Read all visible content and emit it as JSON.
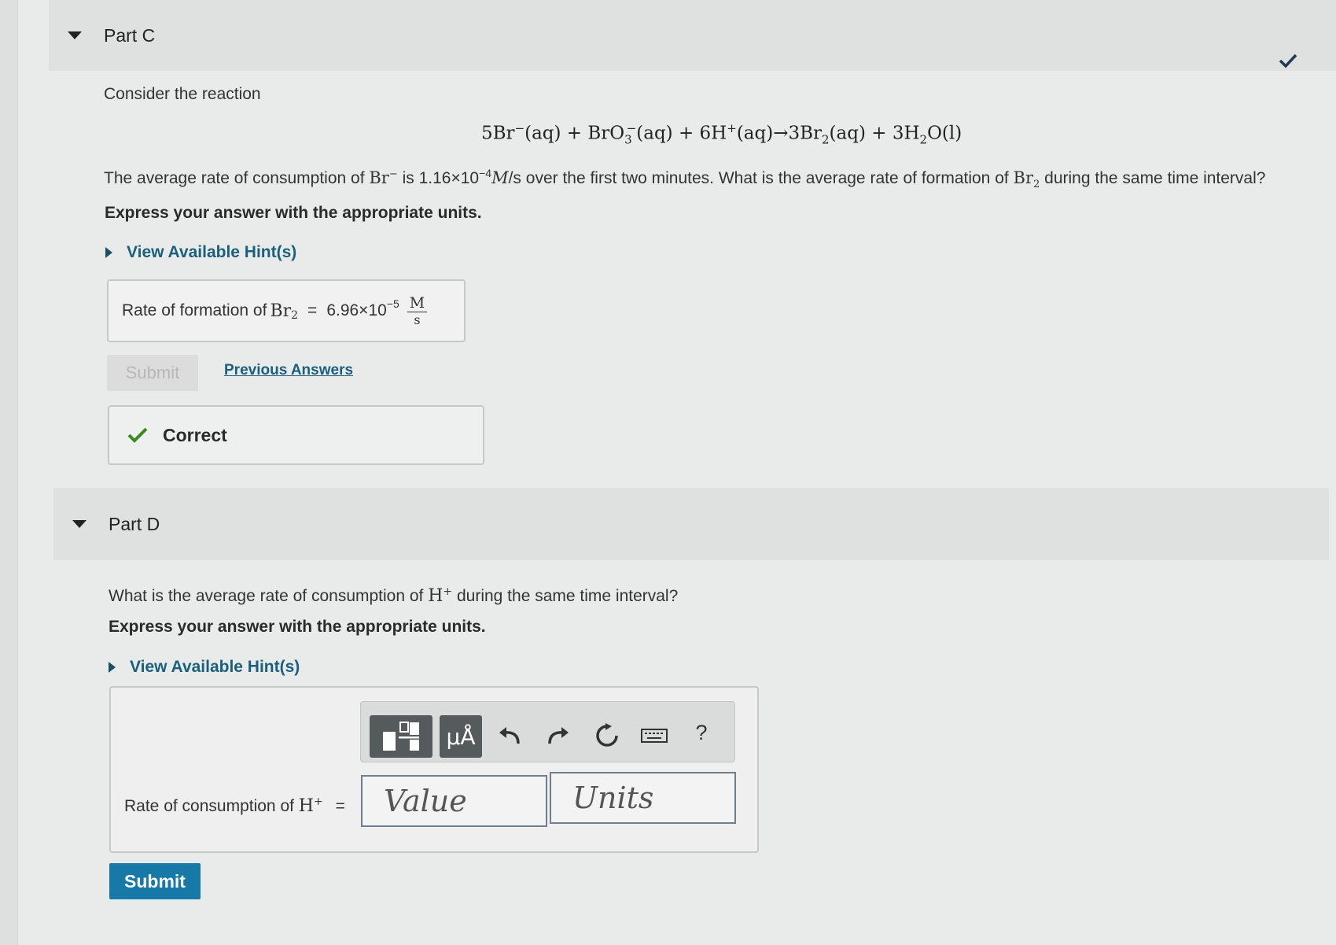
{
  "part_c": {
    "title": "Part C",
    "intro": "Consider the reaction",
    "reaction": {
      "r1": "5Br",
      "r1_sup": "−",
      "r1_state": "(aq) + BrO",
      "r2_sub": "3",
      "r2_sup": "−",
      "r2_state": "(aq) + 6H",
      "r3_sup": "+",
      "r3_state": "(aq)→3Br",
      "p1_sub": "2",
      "p1_state": "(aq) + 3H",
      "p2_sub": "2",
      "p2_state": "O(l)"
    },
    "question": {
      "a": "The average rate of consumption of ",
      "br": "Br",
      "br_sup": "−",
      "b": " is 1.16×10",
      "exp": "−4",
      "unit": "M",
      "c": "/s over the first two minutes. What is the average rate of formation of ",
      "br2": "Br",
      "br2_sub": "2",
      "d": " during the same time interval?"
    },
    "instruction": "Express your answer with the appropriate units.",
    "hint_label": "View Available Hint(s)",
    "answer": {
      "label": "Rate of formation of ",
      "species": "Br",
      "species_sub": "2",
      "equals": "=",
      "value": "6.96×10",
      "value_exp": "−5",
      "unit_num": "M",
      "unit_den": "s"
    },
    "submit_label": "Submit",
    "previous_answers_label": "Previous Answers",
    "feedback": "Correct"
  },
  "part_d": {
    "title": "Part D",
    "question": {
      "a": "What is the average rate of consumption of ",
      "h": "H",
      "h_sup": "+",
      "b": " during the same time interval?"
    },
    "instruction": "Express your answer with the appropriate units.",
    "hint_label": "View Available Hint(s)",
    "toolbar": {
      "units_label": "μÅ",
      "help_label": "?"
    },
    "answer": {
      "label": "Rate of consumption of ",
      "species": "H",
      "species_sup": "+",
      "equals": "=",
      "value_placeholder": "Value",
      "units_placeholder": "Units"
    },
    "submit_label": "Submit"
  },
  "colors": {
    "accent": "#1679a8",
    "link": "#1a5f7c",
    "correct": "#3a8a1f"
  }
}
